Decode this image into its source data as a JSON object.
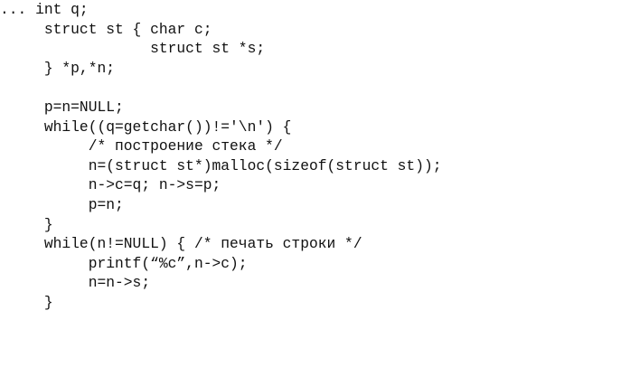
{
  "document": {
    "lines": [
      "... int q;",
      "     struct st { char c;",
      "                 struct st *s;",
      "     } *p,*n;",
      "",
      "     p=n=NULL;",
      "     while((q=getchar())!='\\n') {",
      "          /* построение стека */",
      "          n=(struct st*)malloc(sizeof(struct st));",
      "          n->c=q; n->s=p;",
      "          p=n;",
      "     }",
      "     while(n!=NULL) { /* печать строки */",
      "          printf(“%c”,n->c);",
      "          n=n->s;",
      "     }"
    ]
  }
}
